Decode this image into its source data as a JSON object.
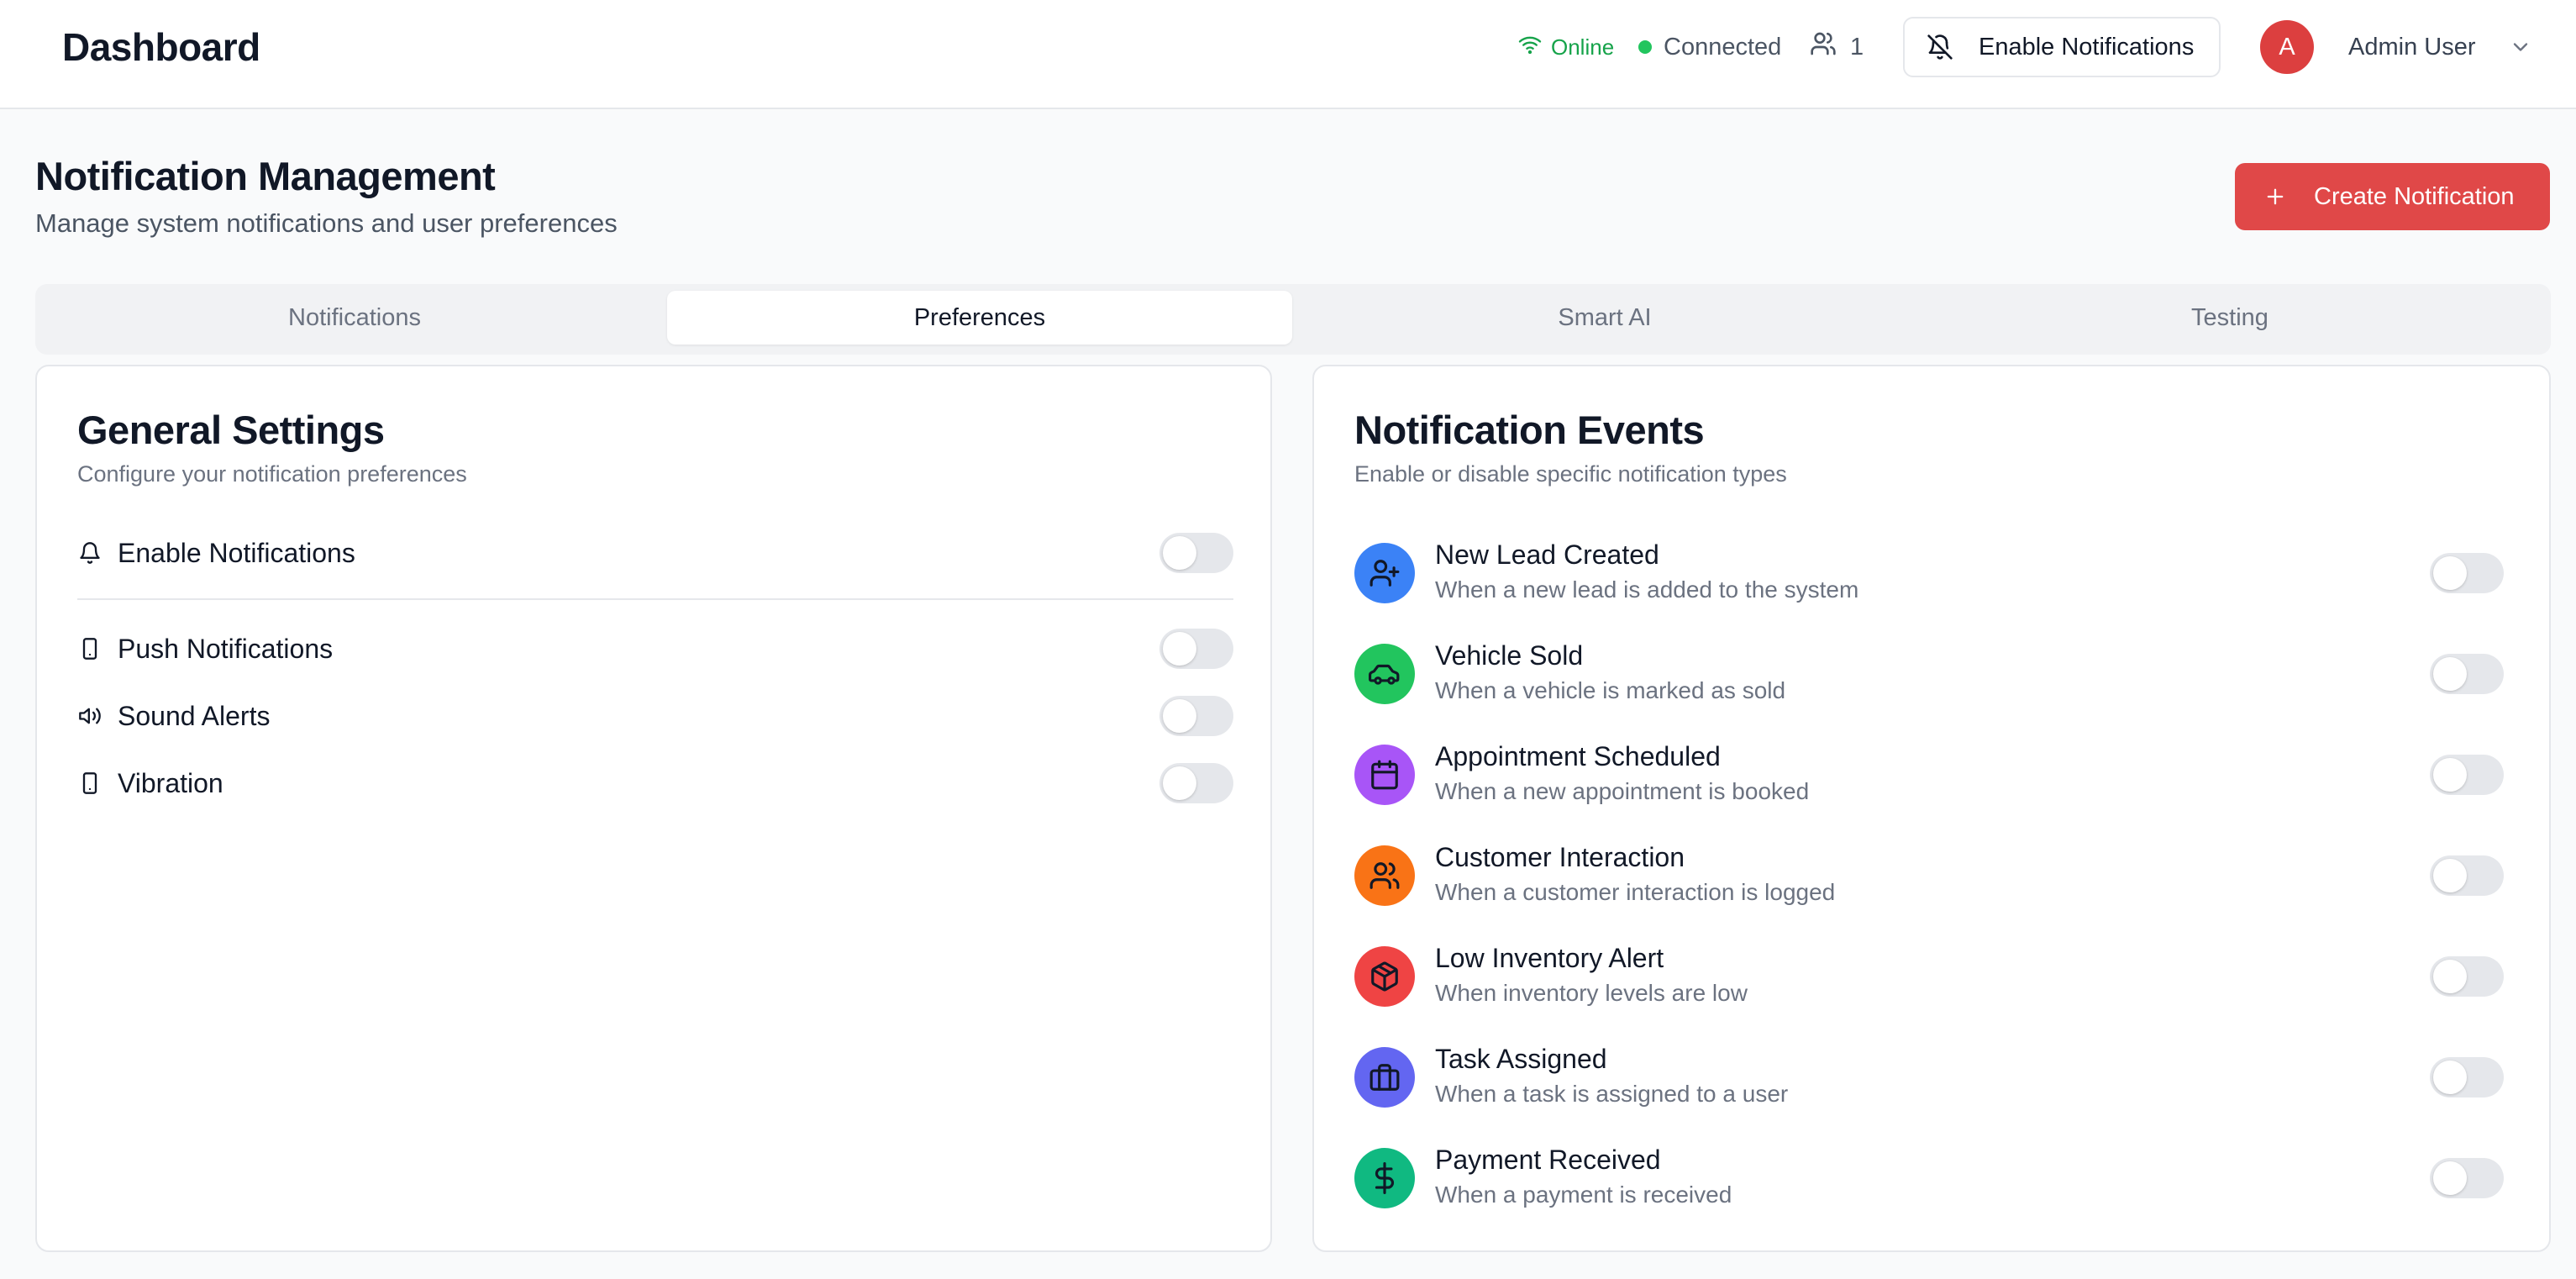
{
  "header": {
    "title": "Dashboard",
    "online_label": "Online",
    "connected_label": "Connected",
    "users_count": "1",
    "enable_notifications_label": "Enable Notifications",
    "avatar_initial": "A",
    "user_name": "Admin User"
  },
  "page": {
    "title": "Notification Management",
    "subtitle": "Manage system notifications and user preferences",
    "create_button_label": "Create Notification"
  },
  "tabs": [
    {
      "label": "Notifications",
      "active": false
    },
    {
      "label": "Preferences",
      "active": true
    },
    {
      "label": "Smart AI",
      "active": false
    },
    {
      "label": "Testing",
      "active": false
    }
  ],
  "general_settings": {
    "title": "General Settings",
    "description": "Configure your notification preferences",
    "items": [
      {
        "label": "Enable Notifications",
        "icon": "bell-icon",
        "enabled": false
      },
      {
        "label": "Push Notifications",
        "icon": "smartphone-icon",
        "enabled": false
      },
      {
        "label": "Sound Alerts",
        "icon": "speaker-icon",
        "enabled": false
      },
      {
        "label": "Vibration",
        "icon": "smartphone-icon",
        "enabled": false
      }
    ]
  },
  "notification_events": {
    "title": "Notification Events",
    "description": "Enable or disable specific notification types",
    "items": [
      {
        "title": "New Lead Created",
        "desc": "When a new lead is added to the system",
        "icon": "user-plus-icon",
        "color": "#3b82f6",
        "enabled": false
      },
      {
        "title": "Vehicle Sold",
        "desc": "When a vehicle is marked as sold",
        "icon": "car-icon",
        "color": "#22c55e",
        "enabled": false
      },
      {
        "title": "Appointment Scheduled",
        "desc": "When a new appointment is booked",
        "icon": "calendar-icon",
        "color": "#a855f7",
        "enabled": false
      },
      {
        "title": "Customer Interaction",
        "desc": "When a customer interaction is logged",
        "icon": "users-icon",
        "color": "#f97316",
        "enabled": false
      },
      {
        "title": "Low Inventory Alert",
        "desc": "When inventory levels are low",
        "icon": "package-icon",
        "color": "#ef4444",
        "enabled": false
      },
      {
        "title": "Task Assigned",
        "desc": "When a task is assigned to a user",
        "icon": "briefcase-icon",
        "color": "#6366f1",
        "enabled": false
      },
      {
        "title": "Payment Received",
        "desc": "When a payment is received",
        "icon": "dollar-icon",
        "color": "#10b981",
        "enabled": false
      }
    ]
  },
  "colors": {
    "accent": "#e04848",
    "online": "#16a34a",
    "connected_dot": "#22c55e",
    "toggle_off": "#e5e7eb"
  }
}
